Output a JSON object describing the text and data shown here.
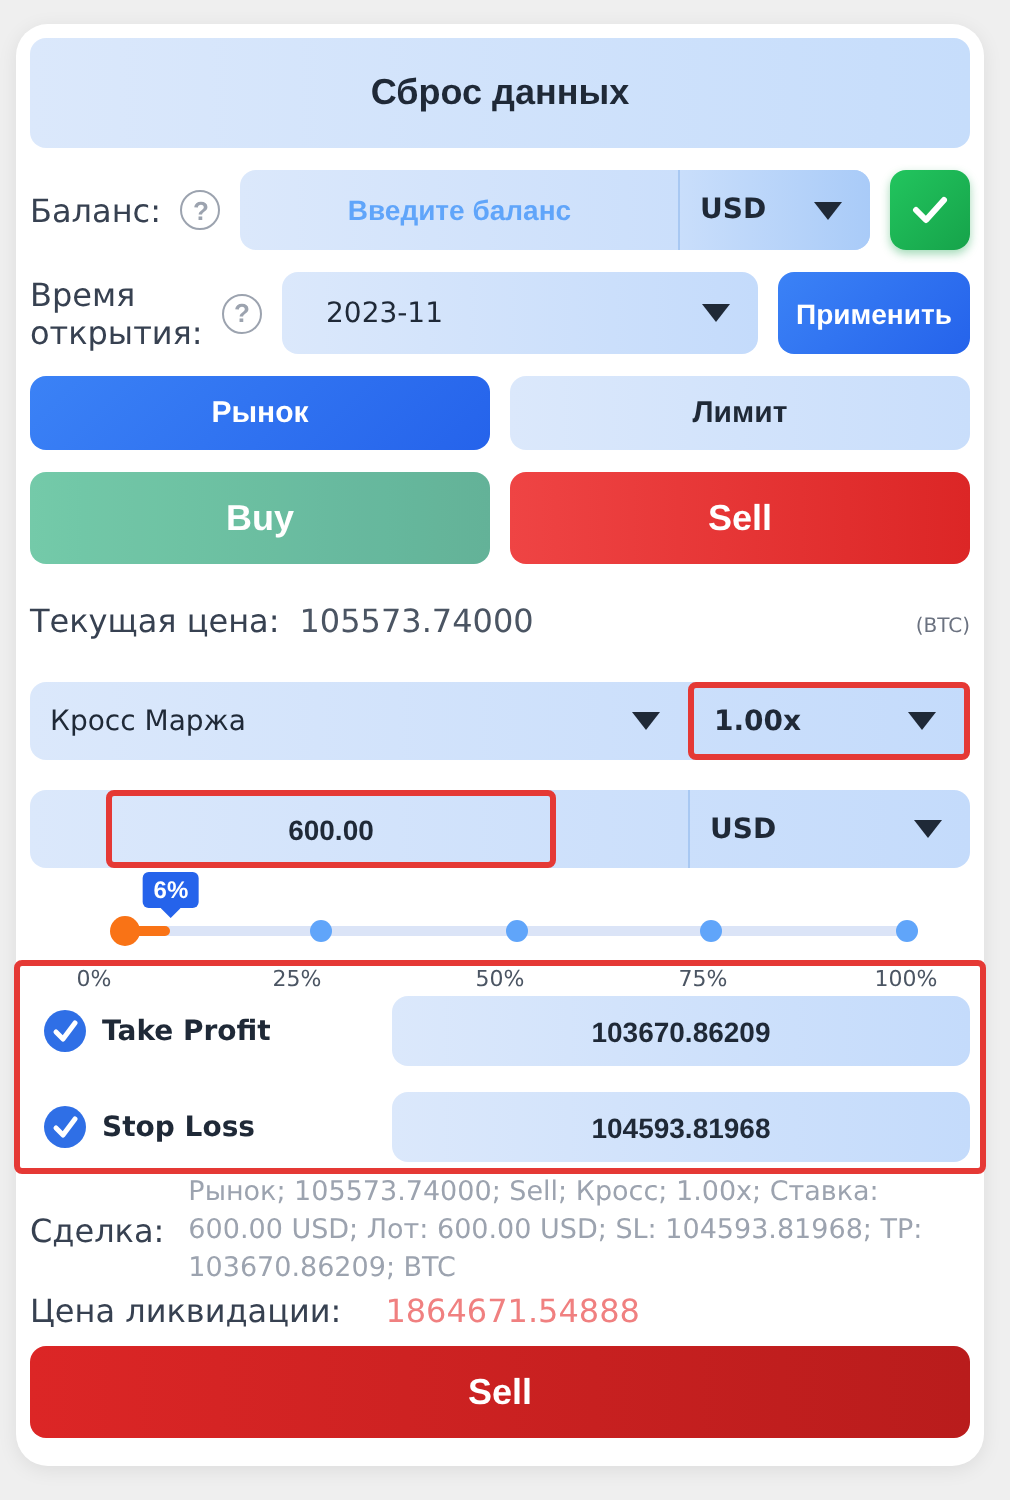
{
  "reset_button": "Сброс данных",
  "balance": {
    "label": "Баланс:",
    "help": "?",
    "placeholder": "Введите баланс",
    "currency": "USD"
  },
  "open_time": {
    "label": "Время открытия:",
    "help": "?",
    "value": "2023-11",
    "apply": "Применить"
  },
  "order_types": [
    {
      "label": "Рынок",
      "selected": true
    },
    {
      "label": "Лимит",
      "selected": false
    }
  ],
  "sides": [
    {
      "label": "Buy",
      "kind": "buy",
      "selected": false
    },
    {
      "label": "Sell",
      "kind": "sell",
      "selected": true
    }
  ],
  "current_price": {
    "label": "Текущая цена:",
    "value": "105573.74000",
    "asset": "(BTC)"
  },
  "margin": {
    "mode": "Кросс Маржа",
    "leverage": "1.00x",
    "leverage_highlighted": true
  },
  "amount": {
    "value": "600.00",
    "currency": "USD",
    "highlighted": true
  },
  "percent": {
    "level": 0.06,
    "badge": "6%",
    "ticks": [
      "0%",
      "25%",
      "50%",
      "75%",
      "100%"
    ]
  },
  "protection": {
    "highlighted": true,
    "rows": [
      {
        "label": "Take Profit",
        "checked": true,
        "value": "103670.86209"
      },
      {
        "label": "Stop Loss",
        "checked": true,
        "value": "104593.81968"
      }
    ]
  },
  "deal": {
    "label": "Сделка:",
    "text": "Рынок; 105573.74000; Sell; Кросс; 1.00x; Ставка: 600.00 USD; Лот: 600.00 USD; SL: 104593.81968; TP: 103670.86209; BTC"
  },
  "liquidation": {
    "label": "Цена ликвидации:",
    "value": "1864671.54888"
  },
  "submit_button": "Sell"
}
